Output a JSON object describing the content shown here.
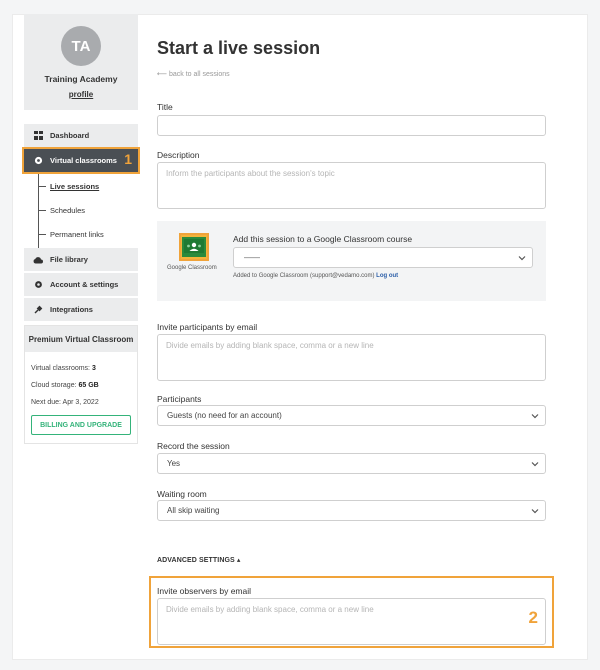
{
  "profile": {
    "initials": "TA",
    "org_name": "Training Academy",
    "profile_link": "profile"
  },
  "menu": {
    "dashboard": "Dashboard",
    "virtual_classrooms": "Virtual classrooms",
    "virtual_classrooms_badge": "1",
    "sub": [
      "Live sessions",
      "Schedules",
      "Permanent links"
    ],
    "file_library": "File library",
    "account_settings": "Account & settings",
    "integrations": "Integrations"
  },
  "premium": {
    "title": "Premium Virtual Classroom",
    "classrooms_label": "Virtual classrooms:",
    "classrooms_value": "3",
    "storage_label": "Cloud storage:",
    "storage_value": "65 GB",
    "next_due": "Next due: Apr 3, 2022",
    "billing_button": "BILLING AND UPGRADE"
  },
  "main": {
    "title": "Start a live session",
    "back_link": "⟵ back to all sessions",
    "title_label": "Title",
    "description_label": "Description",
    "description_placeholder": "Inform the participants about the session's topic",
    "google_classroom": {
      "logo_caption": "Google Classroom",
      "title": "Add this session to a Google Classroom course",
      "select_value": "——",
      "note": "Added to Google Classroom (support@vedamo.com)",
      "logout": "Log out"
    },
    "invite_label": "Invite participants by email",
    "invite_placeholder": "Divide emails by adding blank space, comma or a new line",
    "participants_label": "Participants",
    "participants_value": "Guests (no need for an account)",
    "record_label": "Record the session",
    "record_value": "Yes",
    "waiting_label": "Waiting room",
    "waiting_value": "All skip waiting",
    "advanced": "ADVANCED SETTINGS ▴",
    "observers_label": "Invite observers by email",
    "observers_placeholder": "Divide emails by adding blank space, comma or a new line",
    "observers_badge": "2"
  },
  "colors": {
    "accent_highlight": "#f0a33a",
    "billing_green": "#34b37a",
    "link_blue": "#2b5ea8",
    "active_menu_bg": "#4a4f54"
  }
}
